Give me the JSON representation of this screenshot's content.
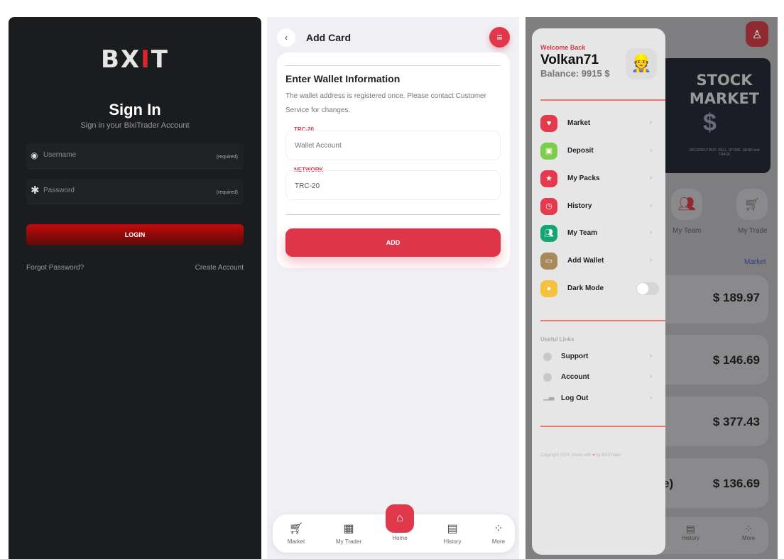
{
  "signin": {
    "logo": "BXIT",
    "title": "Sign In",
    "subtitle": "Sign in your BixiTrader Account",
    "username_placeholder": "Username",
    "password_placeholder": "Password",
    "required": "(required)",
    "login": "LOGIN",
    "forgot": "Forgot Password?",
    "create": "Create Account"
  },
  "addcard": {
    "title": "Add Card",
    "heading": "Enter Wallet Information",
    "description": "The wallet address is registered once. Please contact Customer Service for changes.",
    "wallet_label": "TRC-20",
    "wallet_placeholder": "Wallet Account",
    "network_label": "NETWORK",
    "network_value": "TRC-20",
    "add": "ADD",
    "nav": [
      {
        "label": "Market",
        "icon": "cart-icon"
      },
      {
        "label": "My Trader",
        "icon": "grid-icon"
      },
      {
        "label": "Home",
        "icon": "home-icon"
      },
      {
        "label": "History",
        "icon": "news-icon"
      },
      {
        "label": "More",
        "icon": "more-icon"
      }
    ]
  },
  "menu": {
    "welcome": "Welcome Back",
    "username": "Volkan71",
    "balance": "Balance: 9915 $",
    "items": [
      {
        "label": "Market",
        "color": "#e43a4e"
      },
      {
        "label": "Deposit",
        "color": "#7ccd4c"
      },
      {
        "label": "My Packs",
        "color": "#e43a4e"
      },
      {
        "label": "History",
        "color": "#e43a4e"
      },
      {
        "label": "My Team",
        "color": "#14a574"
      },
      {
        "label": "Add Wallet",
        "color": "#a8895c"
      },
      {
        "label": "Dark Mode",
        "color": "#f6c23e"
      }
    ],
    "dark_mode_on": false,
    "useful_links": "Useful Links",
    "links": [
      "Support",
      "Account",
      "Log Out"
    ],
    "copyright_pre": "Copyright 2024. Made with",
    "copyright_post": "by BixiTrader"
  },
  "background": {
    "banner_line1": "STOCK",
    "banner_line2": "MARKET",
    "banner_tag": "SECURELY BUY, SELL, STORE, SEND and TRACK",
    "my_team": "My Team",
    "my_trade": "My Trade",
    "market_link": "Market",
    "prices": [
      "$ 189.97",
      "$ 146.69",
      "$ 377.43",
      "$ 136.69"
    ],
    "partial_name": "gle)",
    "nav_history": "History",
    "nav_more": "More"
  }
}
